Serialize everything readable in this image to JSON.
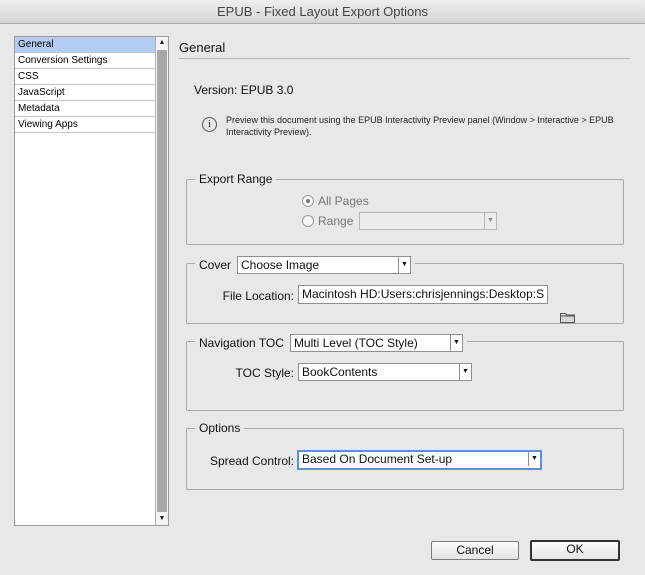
{
  "window": {
    "title": "EPUB - Fixed Layout Export Options"
  },
  "sidebar": {
    "items": [
      {
        "label": "General",
        "selected": true
      },
      {
        "label": "Conversion Settings",
        "selected": false
      },
      {
        "label": "CSS",
        "selected": false
      },
      {
        "label": "JavaScript",
        "selected": false
      },
      {
        "label": "Metadata",
        "selected": false
      },
      {
        "label": "Viewing Apps",
        "selected": false
      }
    ]
  },
  "panel": {
    "title": "General",
    "version": "Version: EPUB 3.0",
    "info_text": "Preview this document using the EPUB Interactivity Preview panel (Window > Interactive > EPUB Interactivity Preview).",
    "info_icon": "info-icon"
  },
  "export_range": {
    "legend": "Export Range",
    "all_pages_label": "All Pages",
    "range_label": "Range",
    "range_value": "",
    "selected": "All Pages"
  },
  "cover": {
    "legend": "Cover",
    "selected": "Choose Image",
    "file_location_label": "File Location:",
    "file_location_value": "Macintosh HD:Users:chrisjennings:Desktop:S"
  },
  "navigation": {
    "legend": "Navigation TOC",
    "selected": "Multi Level (TOC Style)",
    "toc_style_label": "TOC Style:",
    "toc_style_value": "BookContents"
  },
  "options": {
    "legend": "Options",
    "spread_control_label": "Spread Control:",
    "spread_control_value": "Based On Document Set-up"
  },
  "buttons": {
    "cancel": "Cancel",
    "ok": "OK"
  }
}
